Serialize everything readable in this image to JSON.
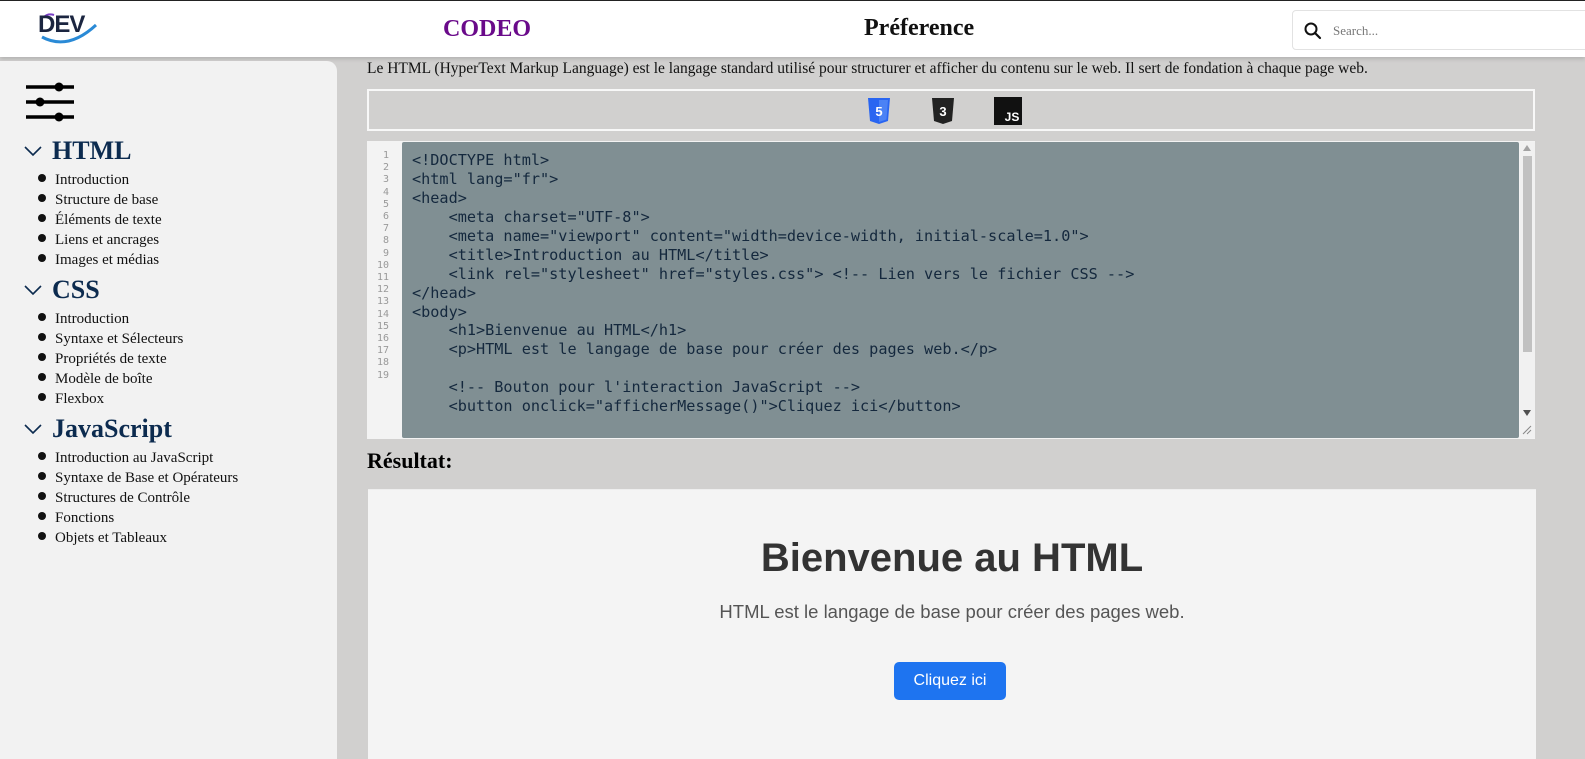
{
  "header": {
    "logo_text": "DEV",
    "brand": "CODEO",
    "title": "Préference",
    "search_placeholder": "Search..."
  },
  "sidebar": {
    "sections": [
      {
        "title": "HTML",
        "items": [
          "Introduction",
          "Structure de base",
          "Éléments de texte",
          "Liens et ancrages",
          "Images et médias"
        ]
      },
      {
        "title": "CSS",
        "items": [
          "Introduction",
          "Syntaxe et Sélecteurs",
          "Propriétés de texte",
          "Modèle de boîte",
          "Flexbox"
        ]
      },
      {
        "title": "JavaScript",
        "items": [
          "Introduction au JavaScript",
          "Syntaxe de Base et Opérateurs",
          "Structures de Contrôle",
          "Fonctions",
          "Objets et Tableaux"
        ]
      }
    ]
  },
  "main": {
    "intro": "Le HTML (HyperText Markup Language) est le langage standard utilisé pour structurer et afficher du contenu sur le web. Il sert de fondation à chaque page web.",
    "languages": [
      {
        "name": "html5-icon",
        "label": "5",
        "color": "#2965f1"
      },
      {
        "name": "css3-icon",
        "label": "3",
        "color": "#222222"
      },
      {
        "name": "js-icon",
        "label": "JS",
        "color": "#111111"
      }
    ],
    "editor": {
      "line_numbers": [
        "1",
        "2",
        "3",
        "4",
        "5",
        "6",
        "7",
        "8",
        "9",
        "10",
        "11",
        "12",
        "13",
        "14",
        "15",
        "16",
        "17",
        "18",
        "19"
      ],
      "lines": [
        "<!DOCTYPE html>",
        "<html lang=\"fr\">",
        "<head>",
        "    <meta charset=\"UTF-8\">",
        "    <meta name=\"viewport\" content=\"width=device-width, initial-scale=1.0\">",
        "    <title>Introduction au HTML</title>",
        "    <link rel=\"stylesheet\" href=\"styles.css\"> <!-- Lien vers le fichier CSS -->",
        "</head>",
        "<body>",
        "    <h1>Bienvenue au HTML</h1>",
        "    <p>HTML est le langage de base pour créer des pages web.</p>",
        "",
        "    <!-- Bouton pour l'interaction JavaScript -->",
        "    <button onclick=\"afficherMessage()\">Cliquez ici</button>"
      ]
    },
    "result_label": "Résultat:",
    "result": {
      "heading": "Bienvenue au HTML",
      "paragraph": "HTML est le langage de base pour créer des pages web.",
      "button_label": "Cliquez ici"
    }
  },
  "colors": {
    "brand": "#6a0a8a",
    "section_title": "#0c2b4f",
    "button": "#1e74f0",
    "code_bg": "#808f93",
    "page_bg": "#d1d0cf"
  }
}
